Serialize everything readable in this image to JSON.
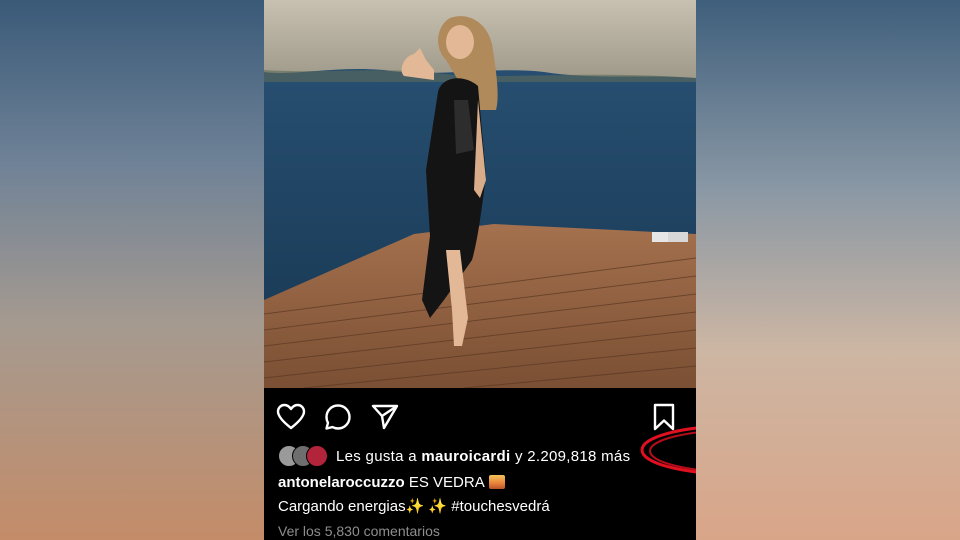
{
  "colors": {
    "background": "#000000",
    "text": "#ffffff",
    "muted": "#8e8e8e",
    "annotation": "#e01020"
  },
  "actions": {
    "like_icon": "heart-icon",
    "comment_icon": "comment-icon",
    "share_icon": "send-icon",
    "save_icon": "bookmark-icon"
  },
  "likes": {
    "prefix": "Les gusta a",
    "username": "mauroicardi",
    "suffix": "y 2.209,818 más"
  },
  "caption": {
    "username": "antonelaroccuzzo",
    "location": "ES VEDRA",
    "text": "Cargando energias✨ ✨ #touchesvedrá"
  },
  "comments": {
    "label": "Ver los 5,830 comentarios"
  }
}
